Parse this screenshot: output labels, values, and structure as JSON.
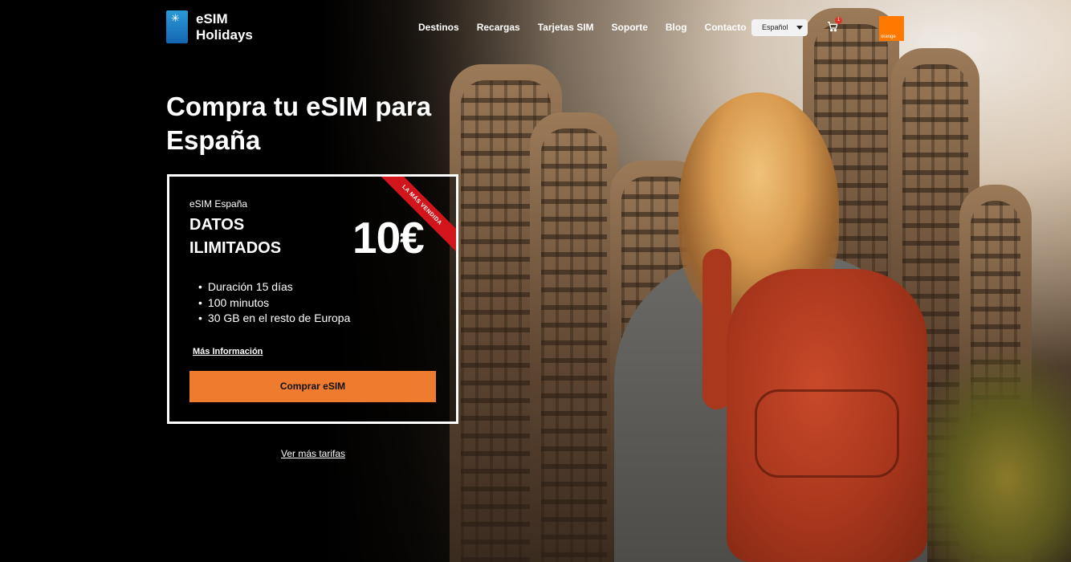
{
  "header": {
    "logo_line1": "eSIM",
    "logo_line2": "Holidays",
    "nav": [
      "Destinos",
      "Recargas",
      "Tarjetas SIM",
      "Soporte",
      "Blog",
      "Contacto"
    ],
    "language": "Español",
    "cart_count": "1",
    "partner_logo": "orange"
  },
  "hero": {
    "title": "Compra tu eSIM para España",
    "card": {
      "ribbon": "LA MÁS VENDIDA",
      "subtitle": "eSIM España",
      "title": "DATOS ILIMITADOS",
      "price": "10€",
      "features": [
        "Duración 15 días",
        "100 minutos",
        "30 GB en el resto de Europa"
      ],
      "more_info": "Más Información",
      "buy_label": "Comprar eSIM"
    },
    "more_rates": "Ver más tarifas"
  },
  "colors": {
    "accent": "#ee7b2e",
    "ribbon": "#d2151b",
    "partner": "#ff7900"
  },
  "icons": {
    "cart": "shopping-cart-icon",
    "dropdown": "chevron-down-icon"
  }
}
